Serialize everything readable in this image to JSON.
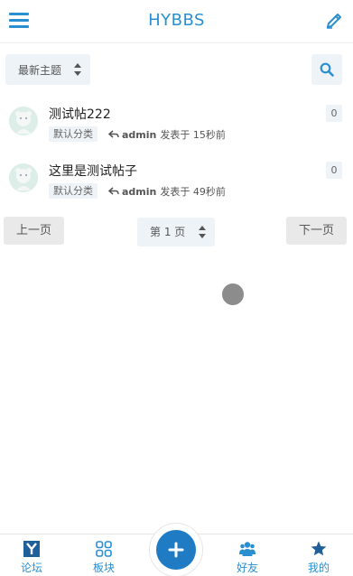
{
  "header": {
    "title": "HYBBS"
  },
  "toolbar": {
    "sort_label": "最新主题"
  },
  "posts": [
    {
      "title": "测试帖222",
      "category": "默认分类",
      "author": "admin",
      "posted": "发表于 15秒前",
      "count": "0"
    },
    {
      "title": "这里是测试帖子",
      "category": "默认分类",
      "author": "admin",
      "posted": "发表于 49秒前",
      "count": "0"
    }
  ],
  "pagination": {
    "prev_label": "上一页",
    "page_label": "第 1 页",
    "next_label": "下一页"
  },
  "tabbar": {
    "items": [
      {
        "label": "论坛",
        "icon": "forum-icon"
      },
      {
        "label": "板块",
        "icon": "grid-icon"
      },
      {
        "label": "好友",
        "icon": "friends-icon"
      },
      {
        "label": "我的",
        "icon": "star-icon"
      }
    ],
    "center_icon": "plus-icon"
  },
  "colors": {
    "accent": "#2a8fd1",
    "plus_button": "#1f7bc4",
    "chip_bg": "#eef3f8",
    "button_grey": "#e9e9e9"
  }
}
